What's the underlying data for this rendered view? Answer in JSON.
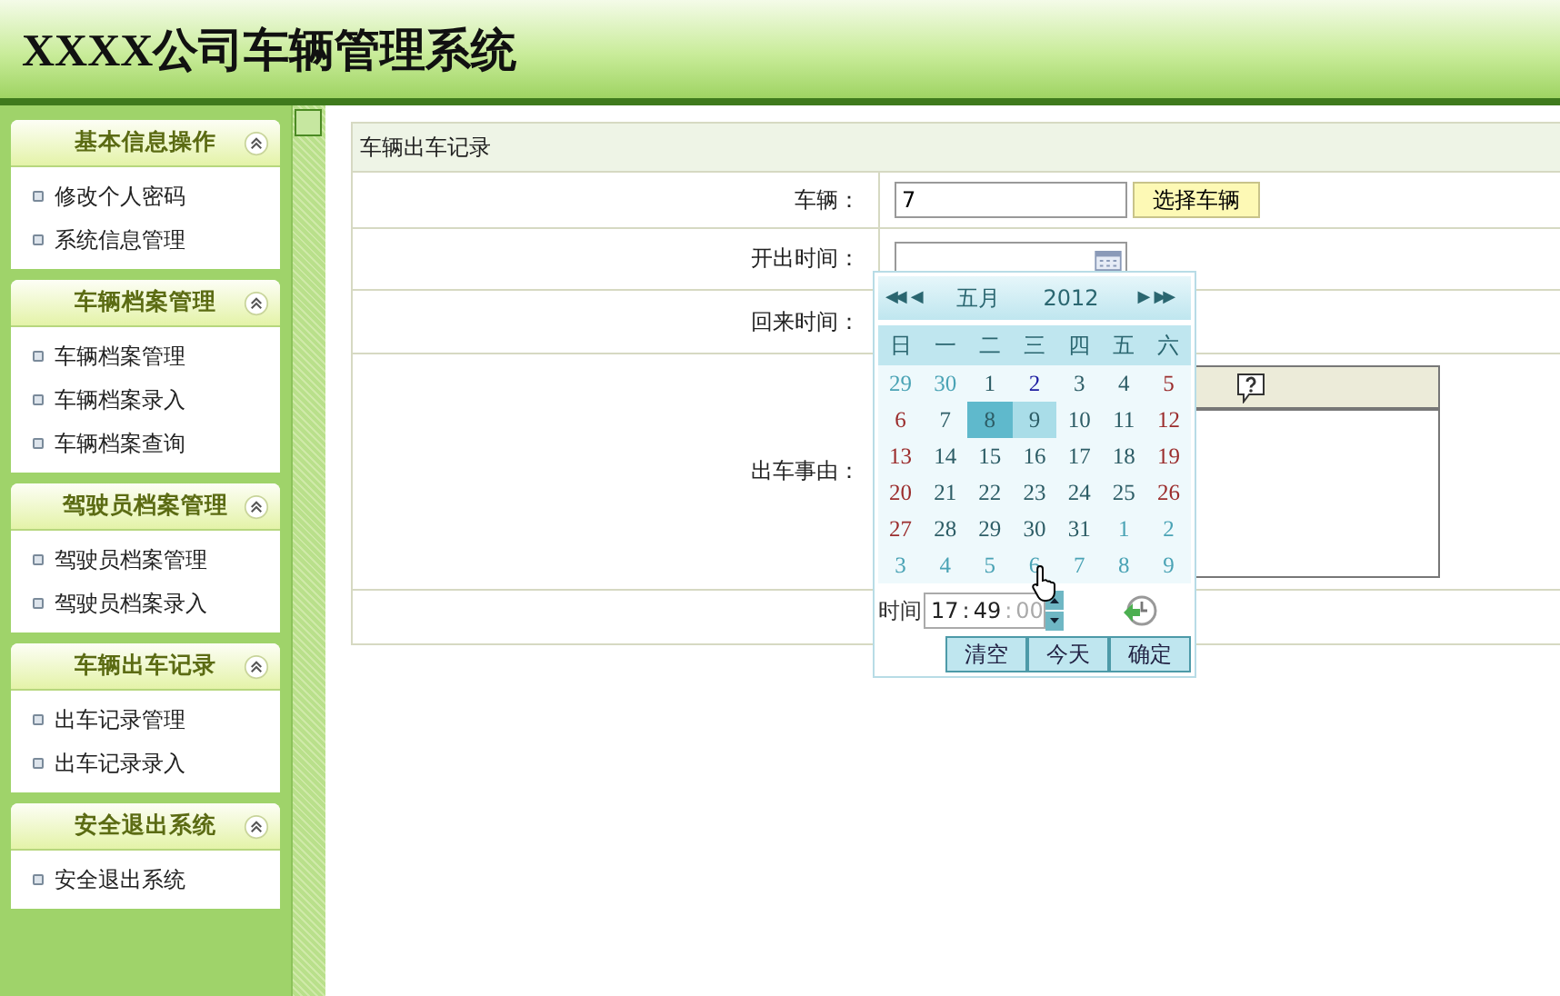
{
  "header": {
    "title": "XXXX公司车辆管理系统"
  },
  "sidebar": {
    "sections": [
      {
        "title": "基本信息操作",
        "expanded": true,
        "items": [
          "修改个人密码",
          "系统信息管理"
        ]
      },
      {
        "title": "车辆档案管理",
        "expanded": true,
        "items": [
          "车辆档案管理",
          "车辆档案录入",
          "车辆档案查询"
        ]
      },
      {
        "title": "驾驶员档案管理",
        "expanded": true,
        "items": [
          "驾驶员档案管理",
          "驾驶员档案录入"
        ]
      },
      {
        "title": "车辆出车记录",
        "expanded": true,
        "items": [
          "出车记录管理",
          "出车记录录入"
        ]
      },
      {
        "title": "安全退出系统",
        "expanded": true,
        "items": [
          "安全退出系统"
        ]
      }
    ]
  },
  "form": {
    "title": "车辆出车记录",
    "vehicle": {
      "label": "车辆：",
      "value": "7",
      "button": "选择车辆"
    },
    "depart": {
      "label": "开出时间："
    },
    "return": {
      "label": "回来时间："
    },
    "reason": {
      "label": "出车事由："
    }
  },
  "calendar": {
    "nav": {
      "prev_year": "◀◀",
      "prev_month": "◀",
      "month": "五月",
      "year": "2012",
      "next_month": "▶",
      "next_year": "▶▶"
    },
    "weekdays": [
      "日",
      "一",
      "二",
      "三",
      "四",
      "五",
      "六"
    ],
    "days": [
      {
        "text": "29",
        "other": true,
        "selected": false,
        "hovered": false,
        "today": false
      },
      {
        "text": "30",
        "other": true,
        "selected": false,
        "hovered": false,
        "today": false
      },
      {
        "text": "1",
        "other": false,
        "selected": false,
        "hovered": false,
        "today": false
      },
      {
        "text": "2",
        "other": false,
        "selected": false,
        "hovered": false,
        "today": true
      },
      {
        "text": "3",
        "other": false,
        "selected": false,
        "hovered": false,
        "today": false
      },
      {
        "text": "4",
        "other": false,
        "selected": false,
        "hovered": false,
        "today": false
      },
      {
        "text": "5",
        "other": false,
        "selected": false,
        "hovered": false,
        "today": false
      },
      {
        "text": "6",
        "other": false,
        "selected": false,
        "hovered": false,
        "today": false
      },
      {
        "text": "7",
        "other": false,
        "selected": false,
        "hovered": false,
        "today": false
      },
      {
        "text": "8",
        "other": false,
        "selected": true,
        "hovered": false,
        "today": false
      },
      {
        "text": "9",
        "other": false,
        "selected": false,
        "hovered": true,
        "today": false
      },
      {
        "text": "10",
        "other": false,
        "selected": false,
        "hovered": false,
        "today": false
      },
      {
        "text": "11",
        "other": false,
        "selected": false,
        "hovered": false,
        "today": false
      },
      {
        "text": "12",
        "other": false,
        "selected": false,
        "hovered": false,
        "today": false
      },
      {
        "text": "13",
        "other": false,
        "selected": false,
        "hovered": false,
        "today": false
      },
      {
        "text": "14",
        "other": false,
        "selected": false,
        "hovered": false,
        "today": false
      },
      {
        "text": "15",
        "other": false,
        "selected": false,
        "hovered": false,
        "today": false
      },
      {
        "text": "16",
        "other": false,
        "selected": false,
        "hovered": false,
        "today": false
      },
      {
        "text": "17",
        "other": false,
        "selected": false,
        "hovered": false,
        "today": false
      },
      {
        "text": "18",
        "other": false,
        "selected": false,
        "hovered": false,
        "today": false
      },
      {
        "text": "19",
        "other": false,
        "selected": false,
        "hovered": false,
        "today": false
      },
      {
        "text": "20",
        "other": false,
        "selected": false,
        "hovered": false,
        "today": false
      },
      {
        "text": "21",
        "other": false,
        "selected": false,
        "hovered": false,
        "today": false
      },
      {
        "text": "22",
        "other": false,
        "selected": false,
        "hovered": false,
        "today": false
      },
      {
        "text": "23",
        "other": false,
        "selected": false,
        "hovered": false,
        "today": false
      },
      {
        "text": "24",
        "other": false,
        "selected": false,
        "hovered": false,
        "today": false
      },
      {
        "text": "25",
        "other": false,
        "selected": false,
        "hovered": false,
        "today": false
      },
      {
        "text": "26",
        "other": false,
        "selected": false,
        "hovered": false,
        "today": false
      },
      {
        "text": "27",
        "other": false,
        "selected": false,
        "hovered": false,
        "today": false
      },
      {
        "text": "28",
        "other": false,
        "selected": false,
        "hovered": false,
        "today": false
      },
      {
        "text": "29",
        "other": false,
        "selected": false,
        "hovered": false,
        "today": false
      },
      {
        "text": "30",
        "other": false,
        "selected": false,
        "hovered": false,
        "today": false
      },
      {
        "text": "31",
        "other": false,
        "selected": false,
        "hovered": false,
        "today": false
      },
      {
        "text": "1",
        "other": true,
        "selected": false,
        "hovered": false,
        "today": false
      },
      {
        "text": "2",
        "other": true,
        "selected": false,
        "hovered": false,
        "today": false
      },
      {
        "text": "3",
        "other": true,
        "selected": false,
        "hovered": false,
        "today": false
      },
      {
        "text": "4",
        "other": true,
        "selected": false,
        "hovered": false,
        "today": false
      },
      {
        "text": "5",
        "other": true,
        "selected": false,
        "hovered": false,
        "today": false
      },
      {
        "text": "6",
        "other": true,
        "selected": false,
        "hovered": false,
        "today": false
      },
      {
        "text": "7",
        "other": true,
        "selected": false,
        "hovered": false,
        "today": false
      },
      {
        "text": "8",
        "other": true,
        "selected": false,
        "hovered": false,
        "today": false
      },
      {
        "text": "9",
        "other": true,
        "selected": false,
        "hovered": false,
        "today": false
      }
    ],
    "time": {
      "label": "时间",
      "hour": "17",
      "minute": "49",
      "second": "00",
      "sep1": ":",
      "sep2": ":"
    },
    "buttons": [
      "清空",
      "今天",
      "确定"
    ]
  }
}
